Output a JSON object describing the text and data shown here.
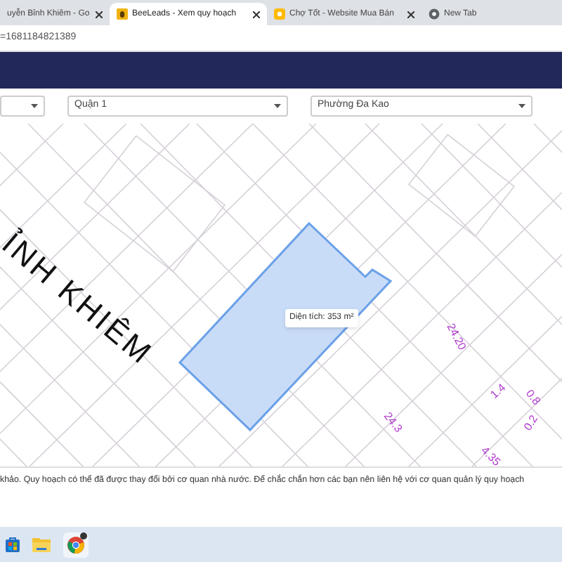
{
  "browser": {
    "tabs": [
      {
        "title": "uyễn Bỉnh Khiêm - Go",
        "selected": false,
        "kind": "none"
      },
      {
        "title": "BeeLeads - Xem quy hoạch",
        "selected": true,
        "kind": "bee"
      },
      {
        "title": "Chợ Tốt - Website Mua Bán",
        "selected": false,
        "kind": "shop"
      },
      {
        "title": "New Tab",
        "selected": false,
        "kind": "globe"
      }
    ],
    "address": "=1681184821389"
  },
  "filters": [
    {
      "value": "Quận 1"
    },
    {
      "value": "Phường Đa Kao"
    }
  ],
  "map": {
    "street": "ỈNH KHIÊM",
    "area_tooltip": "Diện tích: 353 m²",
    "labels": [
      "24.20",
      "24.3",
      "1.4",
      "0.8",
      "0.2",
      "4.35"
    ]
  },
  "notice": "khảo. Quy hoạch có thể đã được thay đổi bởi cơ quan nhà nước. Để chắc chắn hơn các bạn nên liên hệ với cơ quan quản lý quy hoạch"
}
